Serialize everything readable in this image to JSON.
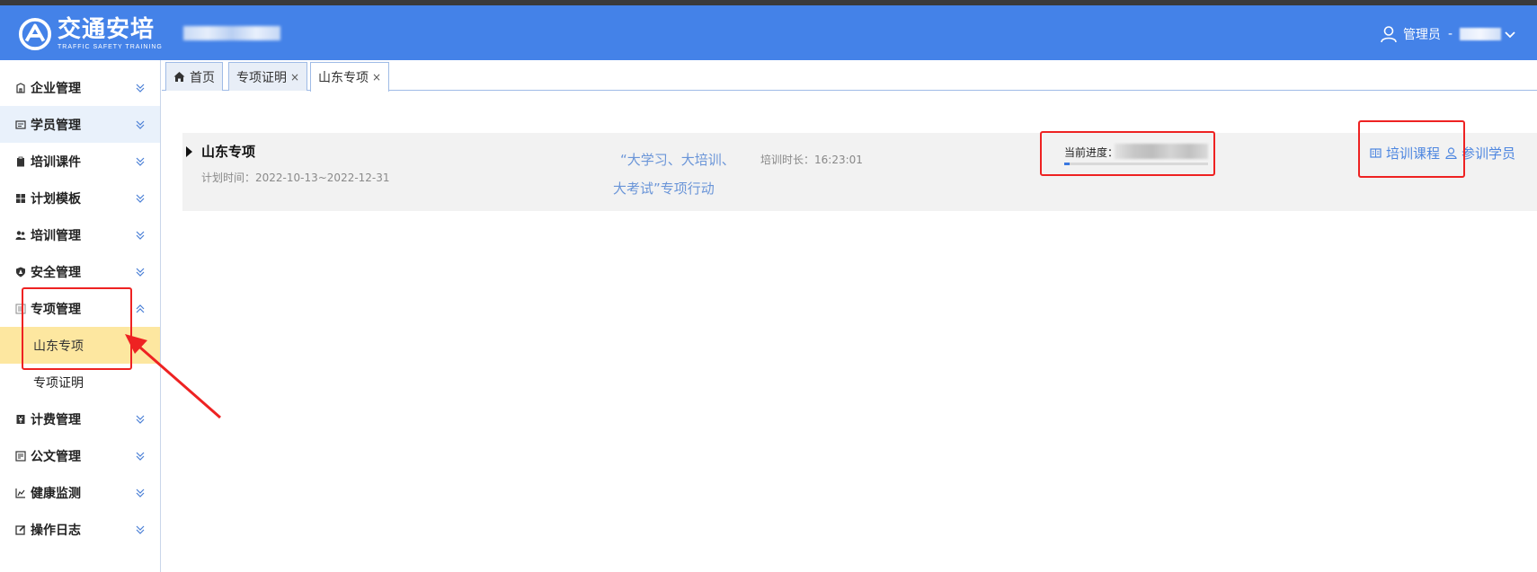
{
  "header": {
    "logo_cn": "交通安培",
    "logo_en": "TRAFFIC SAFETY TRAINING",
    "user_role": "管理员",
    "user_sep": "-"
  },
  "sidebar": {
    "items": [
      {
        "label": "企业管理",
        "icon": "building-icon"
      },
      {
        "label": "学员管理",
        "icon": "id-card-icon"
      },
      {
        "label": "培训课件",
        "icon": "clipboard-icon"
      },
      {
        "label": "计划模板",
        "icon": "grid-icon"
      },
      {
        "label": "培训管理",
        "icon": "users-icon"
      },
      {
        "label": "安全管理",
        "icon": "shield-icon"
      },
      {
        "label": "专项管理",
        "icon": "list-icon"
      },
      {
        "label": "计费管理",
        "icon": "money-icon"
      },
      {
        "label": "公文管理",
        "icon": "document-icon"
      },
      {
        "label": "健康监测",
        "icon": "chart-icon"
      },
      {
        "label": "操作日志",
        "icon": "edit-icon"
      }
    ],
    "sub_items": [
      {
        "label": "山东专项"
      },
      {
        "label": "专项证明"
      }
    ]
  },
  "tabs": [
    {
      "label": "首页"
    },
    {
      "label": "专项证明",
      "close": "×"
    },
    {
      "label": "山东专项",
      "close": "×"
    }
  ],
  "card": {
    "title": "山东专项",
    "plan_time": "计划时间：2022-10-13~2022-12-31",
    "quote_line1": "“大学习、大培训、",
    "quote_line2": "大考试”专项行动",
    "duration": "培训时长：16:23:01",
    "progress_label": "当前进度：",
    "progress_fraction": 0.04,
    "link_courses": "培训课程",
    "link_students": "参训学员"
  },
  "colors": {
    "header_bg": "#4482e8",
    "accent": "#4d86e0",
    "active_submenu": "#fde7a0",
    "annotation": "#ee2222"
  }
}
